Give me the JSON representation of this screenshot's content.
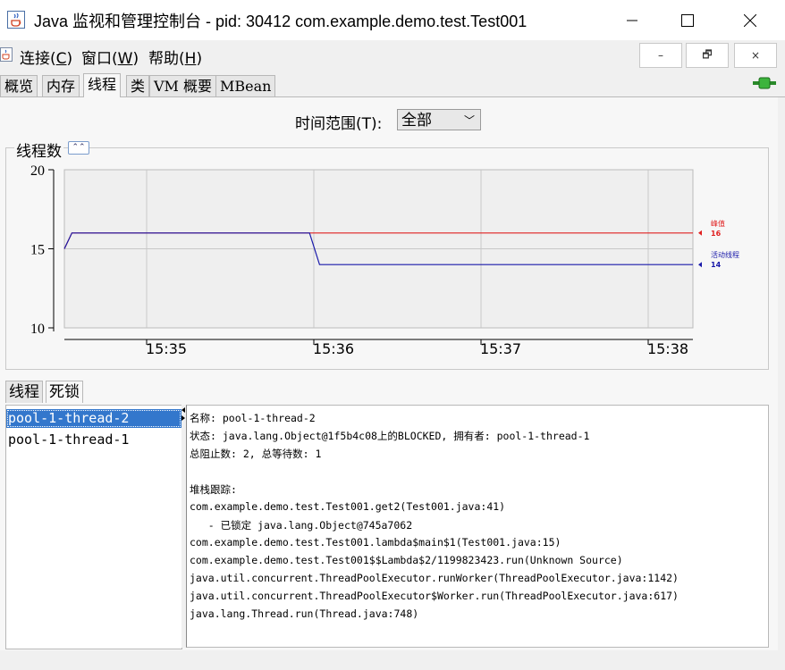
{
  "window": {
    "title": "Java 监视和管理控制台 - pid: 30412 com.example.demo.test.Test001",
    "controls": {
      "minimize": "─",
      "maximize": "☐",
      "close": "✕"
    }
  },
  "menubar": {
    "items": [
      {
        "label": "连接(",
        "key": "C",
        "end": ")"
      },
      {
        "label": "窗口(",
        "key": "W",
        "end": ")"
      },
      {
        "label": "帮助(",
        "key": "H",
        "end": ")"
      }
    ],
    "mdi": {
      "minimize": "–",
      "restore": "🗗",
      "close": "×"
    }
  },
  "tabs": [
    "概览",
    "内存",
    "线程",
    "类",
    "VM 概要",
    "MBean"
  ],
  "active_tab": "线程",
  "time_range": {
    "label": "时间范围(T):",
    "value": "全部"
  },
  "chart_panel": {
    "title": "线程数"
  },
  "chart_data": {
    "type": "line",
    "y_ticks": [
      "20",
      "15",
      "10"
    ],
    "ylim": [
      10,
      20
    ],
    "x_ticks": [
      "15:35",
      "15:36",
      "15:37",
      "15:38"
    ],
    "series": [
      {
        "name": "峰值",
        "value_label": "16",
        "color": "#e02020",
        "points": [
          [
            0,
            15
          ],
          [
            0.012,
            16
          ],
          [
            0.39,
            16
          ],
          [
            1.0,
            16
          ]
        ]
      },
      {
        "name": "活动线程",
        "value_label": "14",
        "color": "#1a1aaa",
        "points": [
          [
            0,
            15
          ],
          [
            0.012,
            16
          ],
          [
            0.39,
            16
          ],
          [
            0.406,
            14
          ],
          [
            1.0,
            14
          ]
        ]
      }
    ]
  },
  "bottom_tabs": [
    "线程",
    "死锁"
  ],
  "active_bottom_tab": "死锁",
  "threads": [
    "pool-1-thread-2",
    "pool-1-thread-1"
  ],
  "selected_thread": "pool-1-thread-2",
  "details": [
    "名称: pool-1-thread-2",
    "状态: java.lang.Object@1f5b4c08上的BLOCKED, 拥有者: pool-1-thread-1",
    "总阻止数: 2, 总等待数: 1",
    "",
    "堆栈跟踪:",
    "com.example.demo.test.Test001.get2(Test001.java:41)",
    "   - 已锁定 java.lang.Object@745a7062",
    "com.example.demo.test.Test001.lambda$main$1(Test001.java:15)",
    "com.example.demo.test.Test001$$Lambda$2/1199823423.run(Unknown Source)",
    "java.util.concurrent.ThreadPoolExecutor.runWorker(ThreadPoolExecutor.java:1142)",
    "java.util.concurrent.ThreadPoolExecutor$Worker.run(ThreadPoolExecutor.java:617)",
    "java.lang.Thread.run(Thread.java:748)"
  ]
}
